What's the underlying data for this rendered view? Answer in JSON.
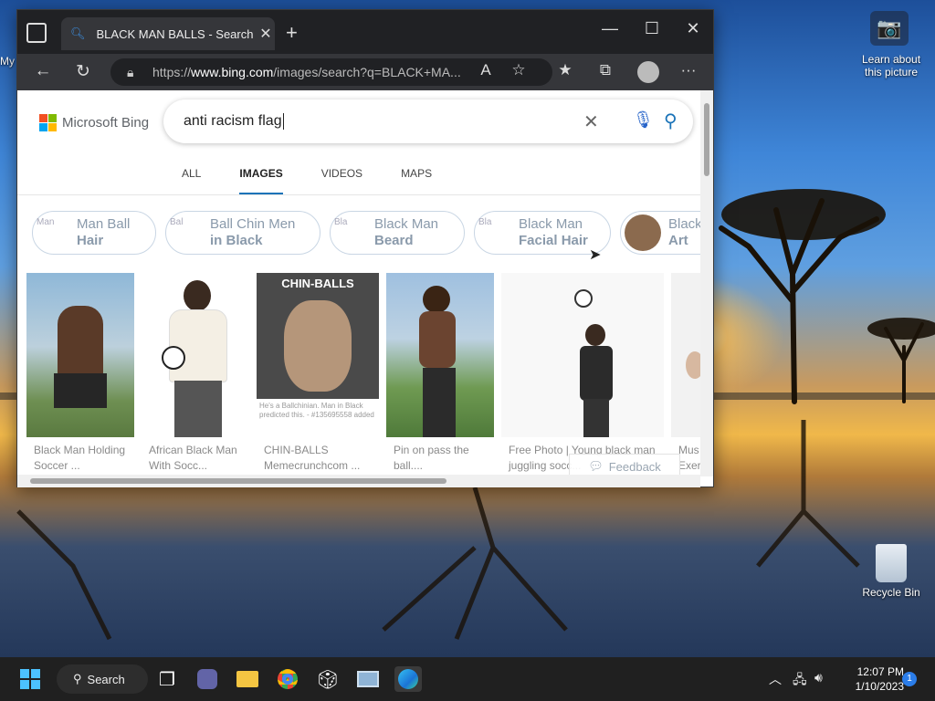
{
  "desktop": {
    "learn_label": "Learn about this picture",
    "left_label": "My",
    "recycle_bin": "Recycle Bin"
  },
  "browser": {
    "tab_title": "BLACK MAN BALLS - Search Imag",
    "url_prefix": "https://",
    "url_host": "www.bing.com",
    "url_path": "/images/search?q=BLACK+MA..."
  },
  "bing": {
    "logo_text": "Microsoft Bing",
    "query": "anti racism flag",
    "scopes": [
      "ALL",
      "IMAGES",
      "VIDEOS",
      "MAPS"
    ],
    "active_scope": "IMAGES",
    "pills": [
      {
        "placeholder": "Man",
        "line1": "Man Ball",
        "line2": "Hair"
      },
      {
        "placeholder": "Bal",
        "line1": "Ball Chin Men",
        "line2": "in Black"
      },
      {
        "placeholder": "Bla",
        "line1": "Black Man",
        "line2": "Beard"
      },
      {
        "placeholder": "Bla",
        "line1": "Black Man",
        "line2": "Facial Hair"
      },
      {
        "placeholder": "",
        "line1": "Black",
        "line2": "Art"
      }
    ],
    "results": [
      {
        "cap1": "Black Man Holding",
        "cap2": "Soccer ..."
      },
      {
        "cap1": "African Black Man",
        "cap2": "With Socc..."
      },
      {
        "cap1": "CHIN-BALLS",
        "cap2": "Memecrunchcom ...",
        "overlay_title": "CHIN-BALLS",
        "overlay_sub": "He's a Ballchinian. Man in Black predicted this. - #135695558 added"
      },
      {
        "cap1": "Pin on pass the",
        "cap2": "ball...."
      },
      {
        "cap1": "Free Photo | Young black man",
        "cap2": "juggling socc..."
      },
      {
        "cap1": "Mus",
        "cap2": "Exer"
      }
    ],
    "feedback_label": "Feedback"
  },
  "taskbar": {
    "search_label": "Search",
    "time": "12:07 PM",
    "date": "1/10/2023",
    "notifications": "1"
  }
}
